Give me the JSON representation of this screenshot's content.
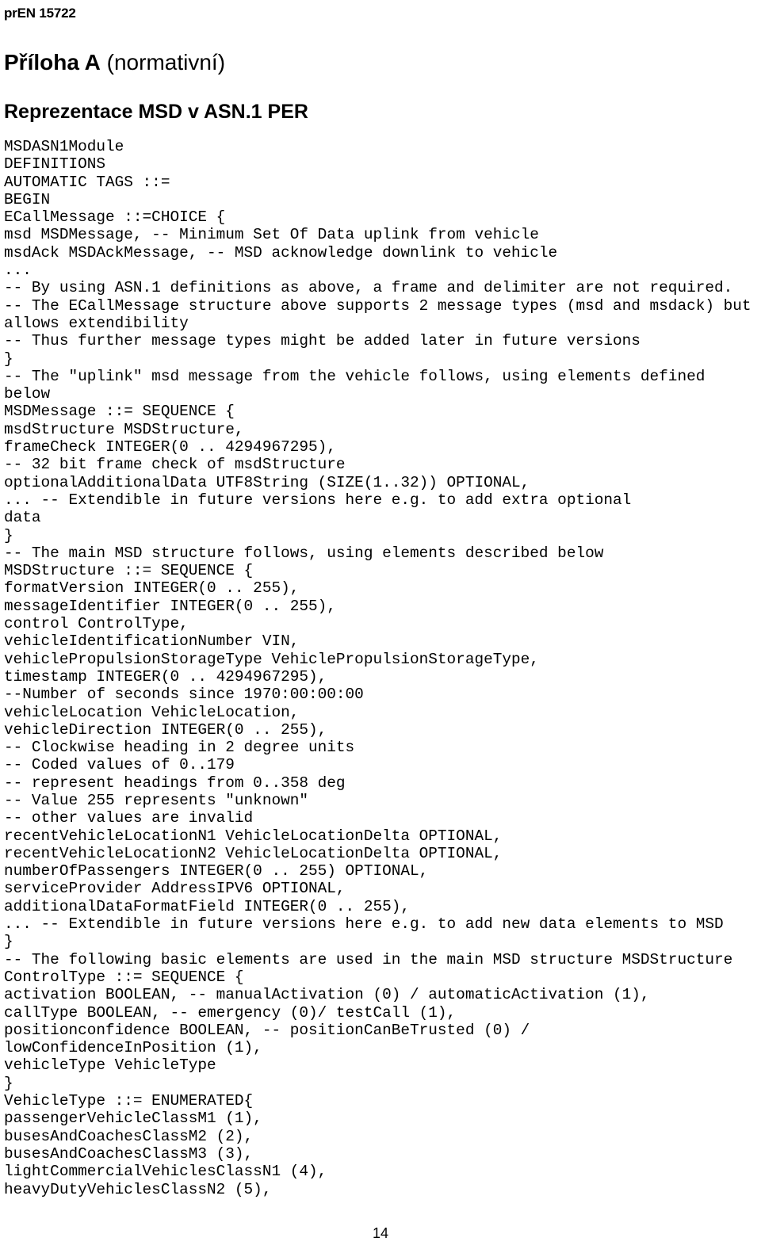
{
  "document": {
    "running_header": "prEN 15722",
    "page_number": "14"
  },
  "annex": {
    "title_bold": "Příloha A",
    "title_rest": " (normativní)"
  },
  "section": {
    "heading": "Reprezentace MSD v ASN.1 PER"
  },
  "code": {
    "language": "ASN.1",
    "lines": [
      "MSDASN1Module",
      "DEFINITIONS",
      "AUTOMATIC TAGS ::=",
      "BEGIN",
      "ECallMessage ::=CHOICE {",
      "msd MSDMessage, -- Minimum Set Of Data uplink from vehicle",
      "msdAck MSDAckMessage, -- MSD acknowledge downlink to vehicle",
      "...",
      "-- By using ASN.1 definitions as above, a frame and delimiter are not required.",
      "-- The ECallMessage structure above supports 2 message types (msd and msdack) but",
      "allows extendibility",
      "-- Thus further message types might be added later in future versions",
      "}",
      "-- The \"uplink\" msd message from the vehicle follows, using elements defined",
      "below",
      "MSDMessage ::= SEQUENCE {",
      "msdStructure MSDStructure,",
      "frameCheck INTEGER(0 .. 4294967295),",
      "-- 32 bit frame check of msdStructure",
      "optionalAdditionalData UTF8String (SIZE(1..32)) OPTIONAL,",
      "... -- Extendible in future versions here e.g. to add extra optional",
      "data",
      "}",
      "-- The main MSD structure follows, using elements described below",
      "MSDStructure ::= SEQUENCE {",
      "formatVersion INTEGER(0 .. 255),",
      "messageIdentifier INTEGER(0 .. 255),",
      "control ControlType,",
      "vehicleIdentificationNumber VIN,",
      "vehiclePropulsionStorageType VehiclePropulsionStorageType,",
      "timestamp INTEGER(0 .. 4294967295),",
      "--Number of seconds since 1970:00:00:00",
      "vehicleLocation VehicleLocation,",
      "vehicleDirection INTEGER(0 .. 255),",
      "-- Clockwise heading in 2 degree units",
      "-- Coded values of 0..179",
      "-- represent headings from 0..358 deg",
      "-- Value 255 represents \"unknown\"",
      "-- other values are invalid",
      "recentVehicleLocationN1 VehicleLocationDelta OPTIONAL,",
      "recentVehicleLocationN2 VehicleLocationDelta OPTIONAL,",
      "numberOfPassengers INTEGER(0 .. 255) OPTIONAL,",
      "serviceProvider AddressIPV6 OPTIONAL,",
      "additionalDataFormatField INTEGER(0 .. 255),",
      "... -- Extendible in future versions here e.g. to add new data elements to MSD",
      "}",
      "-- The following basic elements are used in the main MSD structure MSDStructure",
      "ControlType ::= SEQUENCE {",
      "activation BOOLEAN, -- manualActivation (0) / automaticActivation (1),",
      "callType BOOLEAN, -- emergency (0)/ testCall (1),",
      "positionconfidence BOOLEAN, -- positionCanBeTrusted (0) /",
      "lowConfidenceInPosition (1),",
      "vehicleType VehicleType",
      "}",
      "VehicleType ::= ENUMERATED{",
      "passengerVehicleClassM1 (1),",
      "busesAndCoachesClassM2 (2),",
      "busesAndCoachesClassM3 (3),",
      "lightCommercialVehiclesClassN1 (4),",
      "heavyDutyVehiclesClassN2 (5),"
    ]
  }
}
